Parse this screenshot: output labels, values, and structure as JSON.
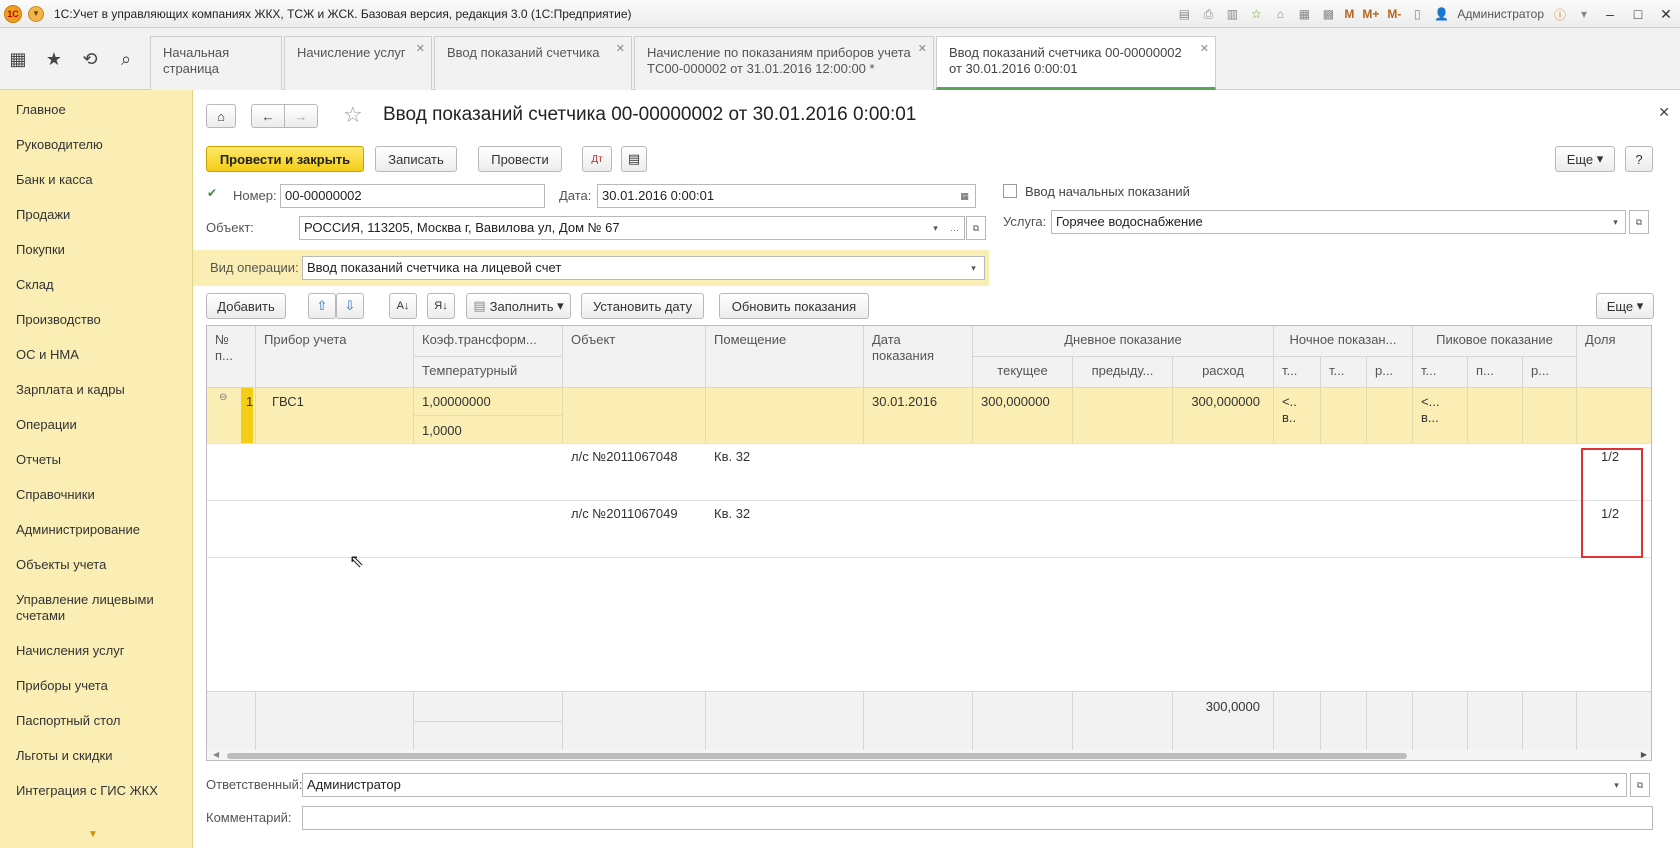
{
  "window": {
    "title": "1С:Учет в управляющих компаниях ЖКХ, ТСЖ и ЖСК. Базовая версия, редакция 3.0  (1С:Предприятие)",
    "user": "Администратор",
    "toolbar_m": [
      "M",
      "M+",
      "M-"
    ]
  },
  "tabs": [
    {
      "label": "Начальная страница",
      "line2": ""
    },
    {
      "label": "Начисление услуг",
      "line2": ""
    },
    {
      "label": "Ввод показаний счетчика",
      "line2": ""
    },
    {
      "label": "Начисление по показаниям приборов учета",
      "line2": "ТС00-000002 от 31.01.2016 12:00:00 *"
    },
    {
      "label": "Ввод показаний счетчика 00-00000002",
      "line2": "от 30.01.2016 0:00:01"
    }
  ],
  "sidebar": {
    "items": [
      "Главное",
      "Руководителю",
      "Банк и касса",
      "Продажи",
      "Покупки",
      "Склад",
      "Производство",
      "ОС и НМА",
      "Зарплата и кадры",
      "Операции",
      "Отчеты",
      "Справочники",
      "Администрирование",
      "Объекты учета",
      "Управление лицевыми счетами",
      "Начисления услуг",
      "Приборы учета",
      "Паспортный стол",
      "Льготы и скидки",
      "Интеграция с ГИС ЖКХ"
    ]
  },
  "doc": {
    "title": "Ввод показаний счетчика 00-00000002 от 30.01.2016 0:00:01",
    "buttons": {
      "post_close": "Провести и закрыть",
      "save": "Записать",
      "post": "Провести",
      "more": "Еще",
      "help": "?"
    },
    "number_label": "Номер:",
    "number": "00-00000002",
    "date_label": "Дата:",
    "date": "30.01.2016  0:00:01",
    "initial_label": "Ввод начальных показаний",
    "object_label": "Объект:",
    "object": "РОССИЯ, 113205, Москва г, Вавилова ул, Дом № 67",
    "service_label": "Услуга:",
    "service": "Горячее водоснабжение",
    "op_label": "Вид операции:",
    "op": "Ввод показаний счетчика на лицевой счет",
    "responsible_label": "Ответственный:",
    "responsible": "Администратор",
    "comment_label": "Комментарий:",
    "comment": ""
  },
  "table_toolbar": {
    "add": "Добавить",
    "fill": "Заполнить",
    "set_date": "Установить дату",
    "refresh": "Обновить показания",
    "more": "Еще"
  },
  "table": {
    "headers": {
      "num": "№ п...",
      "device": "Прибор учета",
      "coef": "Коэф.трансформ...",
      "temp": "Температурный",
      "object": "Объект",
      "room": "Помещение",
      "date": "Дата показания",
      "day": "Дневное показание",
      "day_cur": "текущее",
      "day_prev": "предыду...",
      "day_use": "расход",
      "night": "Ночное показан...",
      "night_sub": [
        "т...",
        "т...",
        "р..."
      ],
      "peak": "Пиковое показание",
      "peak_sub": [
        "т...",
        "п...",
        "р..."
      ],
      "share": "Доля"
    },
    "main_row": {
      "num": "1",
      "device": "ГВС1",
      "coef": "1,00000000",
      "temp": "1,0000",
      "date": "30.01.2016",
      "day_cur": "300,000000",
      "day_use": "300,000000",
      "night": "<..",
      "night2": "в..",
      "peak": "<...",
      "peak2": "в..."
    },
    "sub_rows": [
      {
        "object": "л/с №2011067048",
        "room": "Кв. 32",
        "share": "1/2"
      },
      {
        "object": "л/с №2011067049",
        "room": "Кв. 32",
        "share": "1/2"
      }
    ],
    "total_use": "300,0000"
  }
}
